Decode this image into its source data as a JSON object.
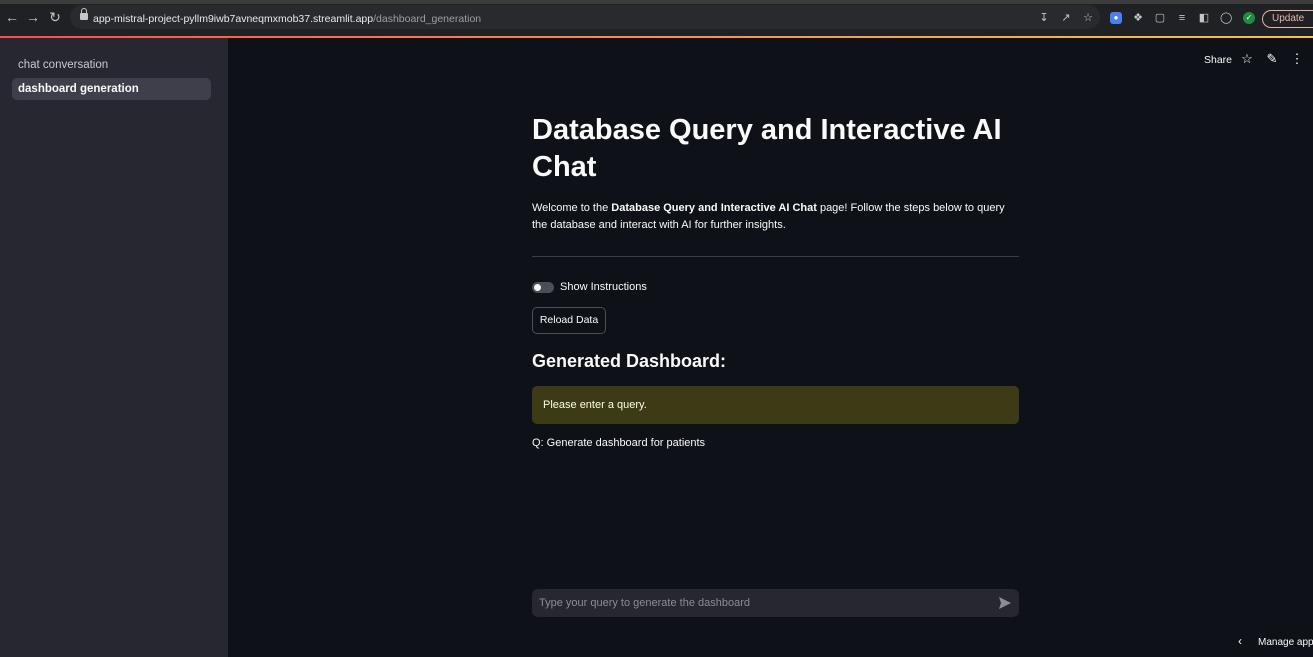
{
  "browser": {
    "url_host": "app-mistral-project-pyllm9iwb7avneqmxmob37.streamlit.app",
    "url_path": "/dashboard_generation",
    "update_label": "Update"
  },
  "sidebar": {
    "items": [
      {
        "label": "chat conversation"
      },
      {
        "label": "dashboard generation"
      }
    ]
  },
  "toolbar": {
    "share_label": "Share"
  },
  "main": {
    "title": "Database Query and Interactive AI Chat",
    "welcome_prefix": "Welcome to the ",
    "welcome_bold": "Database Query and Interactive AI Chat",
    "welcome_suffix": " page! Follow the steps below to query the database and interact with AI for further insights.",
    "toggle_label": "Show Instructions",
    "reload_label": "Reload Data",
    "section_heading": "Generated Dashboard:",
    "warning_text": "Please enter a query.",
    "question_text": "Q: Generate dashboard for patients",
    "chat_placeholder": "Type your query to generate the dashboard"
  },
  "footer": {
    "manage_app_label": "Manage app"
  },
  "colors": {
    "background": "#0e1117",
    "sidebar": "#262730",
    "warning_bg": "#3d3a16",
    "warning_text": "#fffde7"
  }
}
